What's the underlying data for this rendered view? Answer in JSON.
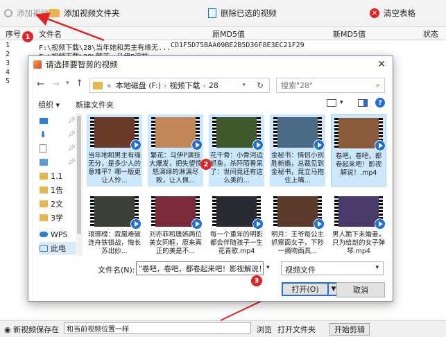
{
  "toolbar": {
    "add_video": "添加视频",
    "add_folder": "添加视频文件夹",
    "delete_selected": "删除已选的视频",
    "clear_table": "清空表格"
  },
  "table": {
    "headers": {
      "index": "序号",
      "filename": "文件名",
      "orig_md5": "原MD5值",
      "new_md5": "新MD5值",
      "status": "状态"
    },
    "rows": [
      {
        "index": "1",
        "filename": "F:\\视频下载\\28\\当年她和男主有缘无...",
        "orig_md5": "CD1F5D75BAA09BE2B5D36F8E3EC21F29"
      },
      {
        "index": "2",
        "filename": "F:\\视频下载\\28\\繁花，马伊P演技...",
        "orig_md5": ""
      },
      {
        "index": "3",
        "filename": "",
        "orig_md5": ""
      },
      {
        "index": "4",
        "filename": "",
        "orig_md5": ""
      },
      {
        "index": "5",
        "filename": "",
        "orig_md5": ""
      }
    ]
  },
  "dialog": {
    "title": "请选择要智剪的视频",
    "breadcrumb": [
      "«",
      "本地磁盘 (F:)",
      "视频下载",
      "28"
    ],
    "search_placeholder": "搜索\"28\"",
    "organize": "组织 ▾",
    "new_folder": "新建文件夹",
    "nav_items": [
      "",
      "",
      "",
      "",
      "1.1",
      "1告",
      "2文",
      "3学",
      "WPS",
      "此电"
    ],
    "tiles": [
      {
        "label": "当年地和男主有缘无分，是多少人的意难平？哪一版更让人怜...",
        "selected": true,
        "color": "#6a3b2a"
      },
      {
        "label": "繁花：马伊P演技大爆发，把失望愤怒演绎的淋漓尽致，让人佩...",
        "selected": true,
        "color": "#c3875a"
      },
      {
        "label": "花千骨：小骨河边抓鱼，杀阡陌看呆了：世间竟还有这么美的...",
        "selected": true,
        "color": "#3e5a2c"
      },
      {
        "label": "金秘书：情侣小别胜新婚，总裁见到金秘书，竟立马抱住上嘴...",
        "selected": true,
        "color": "#4a6a86"
      },
      {
        "label": "卷吧，卷吧，都卷起来吧！影视解说！.mp4",
        "selected": true,
        "color": "#8a5a3a"
      },
      {
        "label": "琅琊榜：霓凰难破连舟铁锁战，悔长苏出妙...",
        "selected": false,
        "color": "#3a4038"
      },
      {
        "label": "刘亦菲和唐嫣两位美女同框，原来真正的美是不...",
        "selected": false,
        "color": "#7a2a3a"
      },
      {
        "label": "每一个重年的明影都会伴随孩子一生花青歌.mp4",
        "selected": false,
        "color": "#2a2a32"
      },
      {
        "label": "明月：王爷每公主抓察面女子，下秒一摘吻面具...",
        "selected": false,
        "color": "#5a3a2a"
      },
      {
        "label": "男人跪下未婚妻，只为给剖的女子弹琴.mp4",
        "selected": false,
        "color": "#4a3a6a"
      }
    ],
    "filename_label": "文件名(N):",
    "filename_value": "\"卷吧，卷吧，都卷起来吧！影视解说！.mp4\" \"当年她",
    "filter": "视频文件",
    "open_button": "打开(O)",
    "cancel_button": "取消"
  },
  "bottom": {
    "output_label": "◉ 新视频保存在",
    "output_value": "和当前视频位置一样",
    "browse": "浏览",
    "open_dir": "打开文件夹",
    "start": "开始剪辑"
  },
  "badges": [
    "1",
    "2",
    "3"
  ],
  "colors": {
    "badge": "#e02323",
    "arrow": "#e02323",
    "selection": "#cce8ff",
    "accent": "#1e6fd8"
  }
}
